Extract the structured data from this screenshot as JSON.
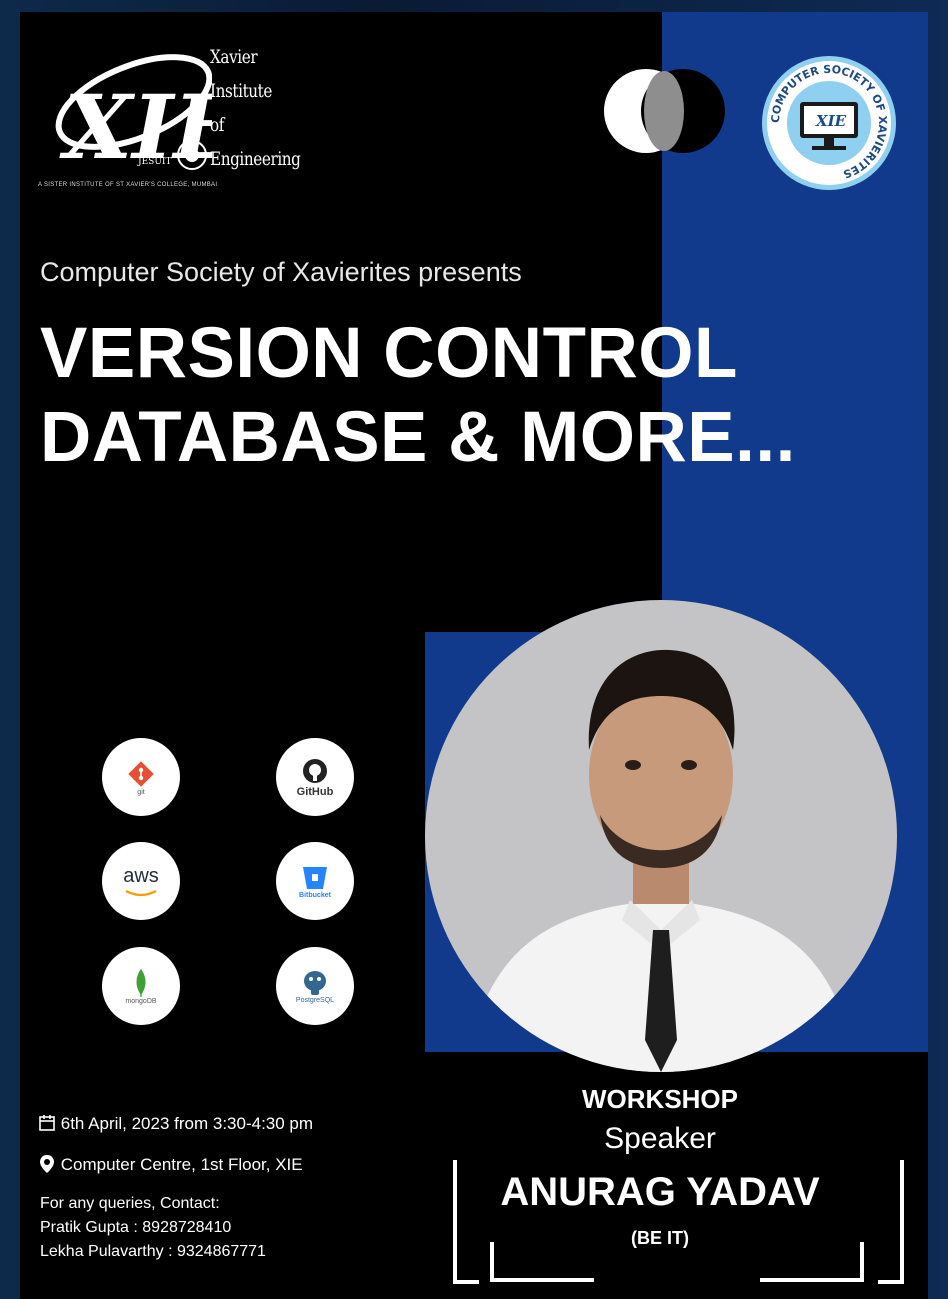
{
  "logo": {
    "mark": "XIE",
    "seal_text": "JESUIT",
    "name_lines": [
      "Xavier",
      "Institute",
      "of",
      "Engineering"
    ],
    "subtitle": "A SISTER INSTITUTE OF ST XAVIER'S COLLEGE, MUMBAI"
  },
  "society_seal": {
    "ring_text": "COMPUTER SOCIETY OF XAVIERITES",
    "mark": "XIE"
  },
  "presents": "Computer Society of Xavierites presents",
  "title": {
    "line1": "VERSION CONTROL",
    "line2": "DATABASE & MORE..."
  },
  "tools": [
    {
      "name": "git",
      "icon": "git-icon"
    },
    {
      "name": "GitHub",
      "icon": "github-icon"
    },
    {
      "name": "aws",
      "icon": "aws-icon"
    },
    {
      "name": "Bitbucket",
      "icon": "bitbucket-icon"
    },
    {
      "name": "mongoDB",
      "icon": "mongodb-icon"
    },
    {
      "name": "PostgreSQL",
      "icon": "postgresql-icon"
    }
  ],
  "event": {
    "date": "6th April, 2023 from 3:30-4:30 pm",
    "venue": "Computer Centre, 1st Floor, XIE",
    "contact_heading": "For any queries, Contact:",
    "contacts": [
      "Pratik Gupta : 8928728410",
      "Lekha Pulavarthy : 9324867771"
    ]
  },
  "speaker": {
    "workshop_label": "WORKSHOP",
    "speaker_label": "Speaker",
    "name": "ANURAG YADAV",
    "role": "(BE IT)"
  },
  "colors": {
    "background": "#000000",
    "accent_blue": "#123a8c",
    "text": "#ffffff",
    "git": "#e84e31",
    "mongodb": "#3fa037",
    "postgres": "#336791",
    "bitbucket": "#2684ff"
  }
}
